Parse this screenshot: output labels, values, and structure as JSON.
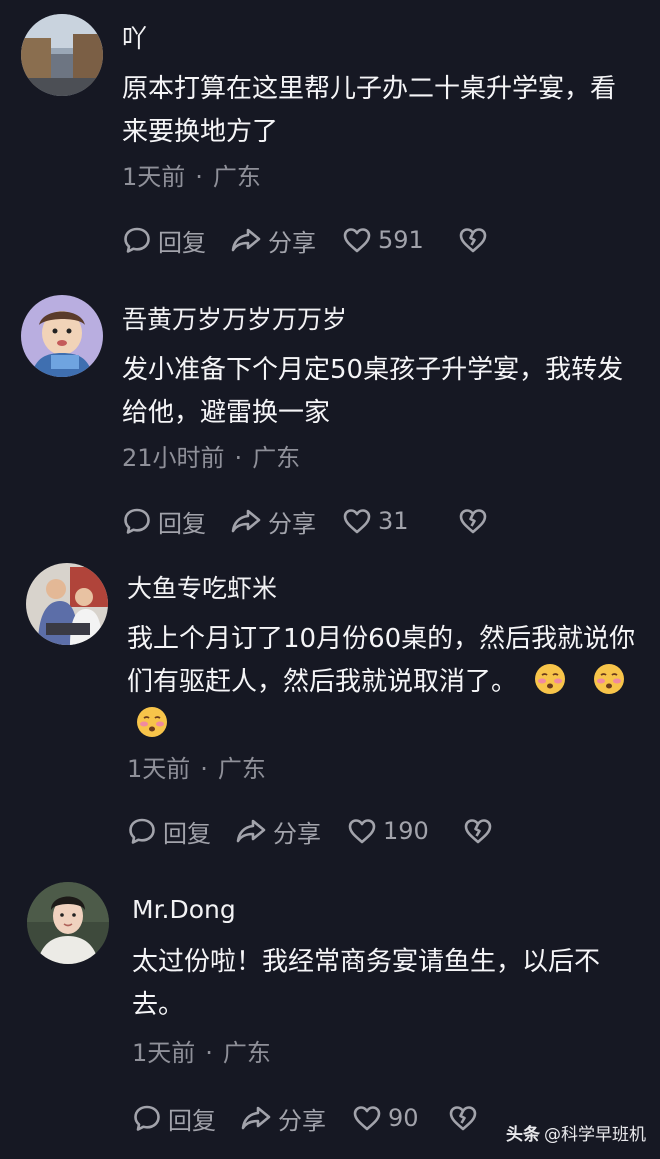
{
  "comments": [
    {
      "username": "吖",
      "text": "原本打算在这里帮儿子办二十桌升学宴，看来要换地方了",
      "time": "1天前",
      "location": "广东",
      "reply_label": "回复",
      "share_label": "分享",
      "likes": "591"
    },
    {
      "username": "吾黄万岁万岁万万岁",
      "text": "发小准备下个月定50桌孩子升学宴，我转发给他，避雷换一家",
      "time": "21小时前",
      "location": "广东",
      "reply_label": "回复",
      "share_label": "分享",
      "likes": "31"
    },
    {
      "username": "大鱼专吃虾米",
      "text": "我上个月订了10月份60桌的，然后我就说你们有驱赶人，然后我就说取消了。",
      "emoji_count": 3,
      "time": "1天前",
      "location": "广东",
      "reply_label": "回复",
      "share_label": "分享",
      "likes": "190"
    },
    {
      "username": "Mr.Dong",
      "text": "太过份啦！我经常商务宴请鱼生，以后不去。",
      "time": "1天前",
      "location": "广东",
      "reply_label": "回复",
      "share_label": "分享",
      "likes": "90"
    }
  ],
  "watermark": {
    "brand": "头条",
    "handle": "@科学早班机"
  },
  "colors": {
    "background": "#161823",
    "primary_text": "#f5f5f7",
    "secondary_text": "#8f9099",
    "action_text": "#a2a3ab"
  }
}
